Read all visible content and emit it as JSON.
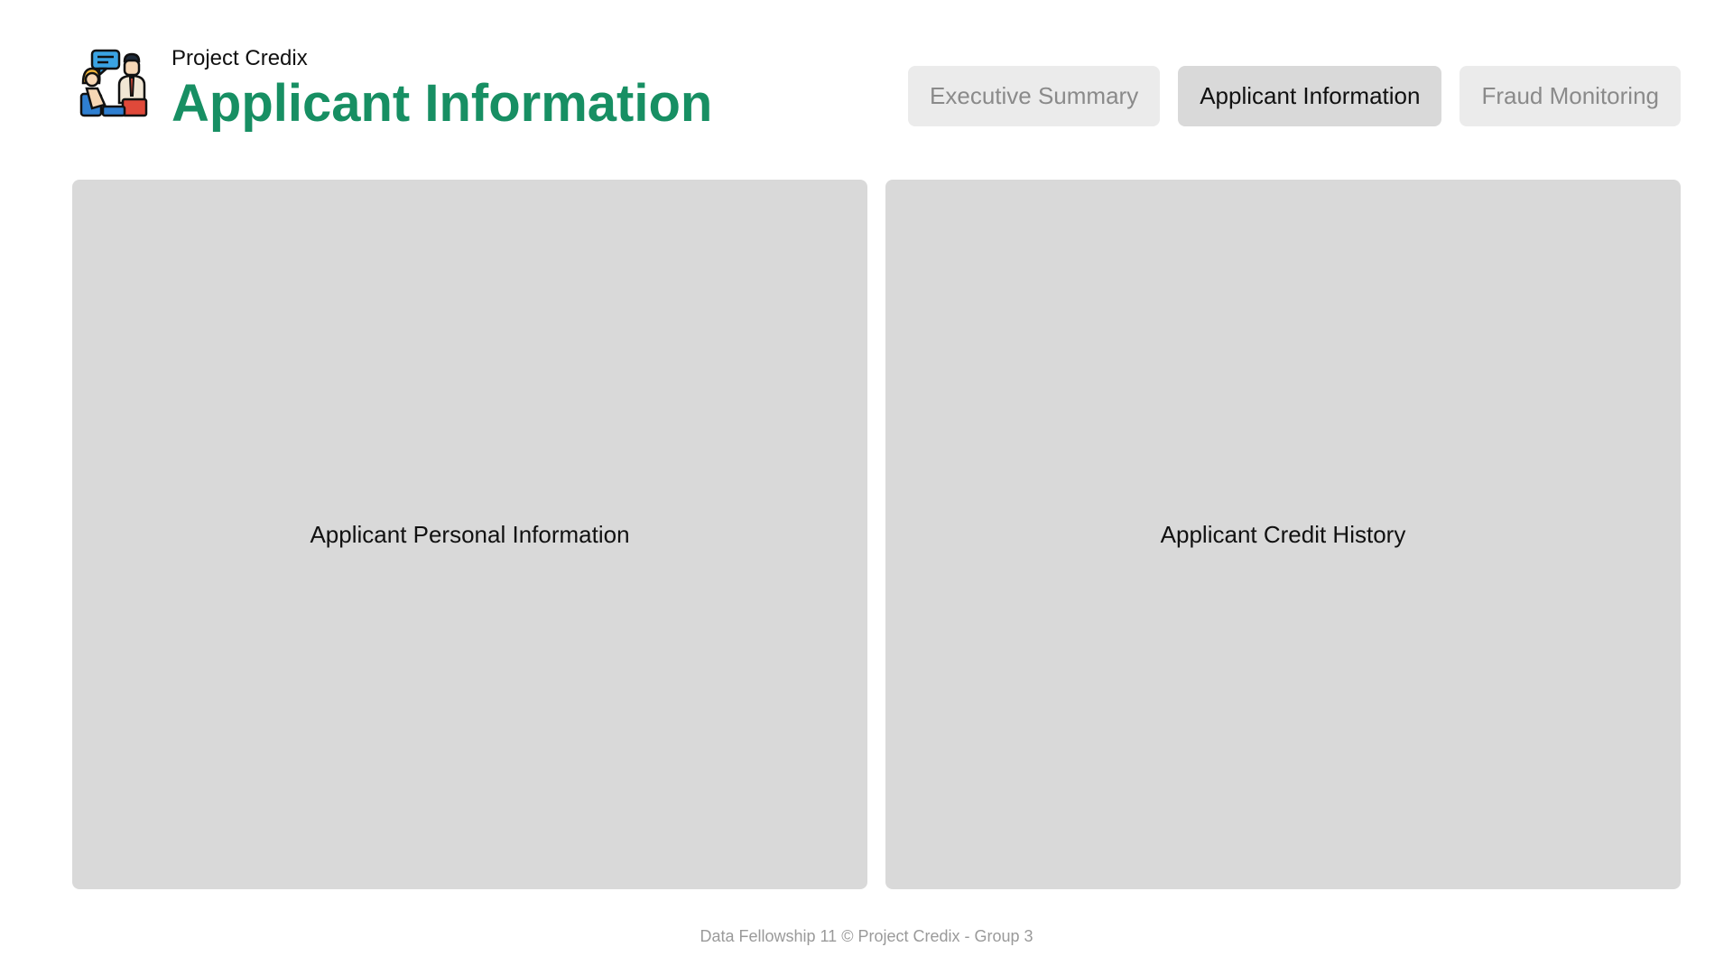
{
  "header": {
    "project_name": "Project Credix",
    "page_title": "Applicant Information",
    "logo_icon": "interview-people-icon"
  },
  "tabs": [
    {
      "label": "Executive Summary",
      "active": false
    },
    {
      "label": "Applicant Information",
      "active": true
    },
    {
      "label": "Fraud Monitoring",
      "active": false
    }
  ],
  "panels": {
    "left_label": "Applicant Personal Information",
    "right_label": "Applicant Credit History"
  },
  "footer": {
    "text": "Data Fellowship 11 © Project Credix - Group 3"
  },
  "colors": {
    "title_green": "#178f63",
    "panel_gray": "#d9d9d9",
    "tab_gray": "#ebebeb",
    "tab_active_gray": "#d9d9d9"
  }
}
